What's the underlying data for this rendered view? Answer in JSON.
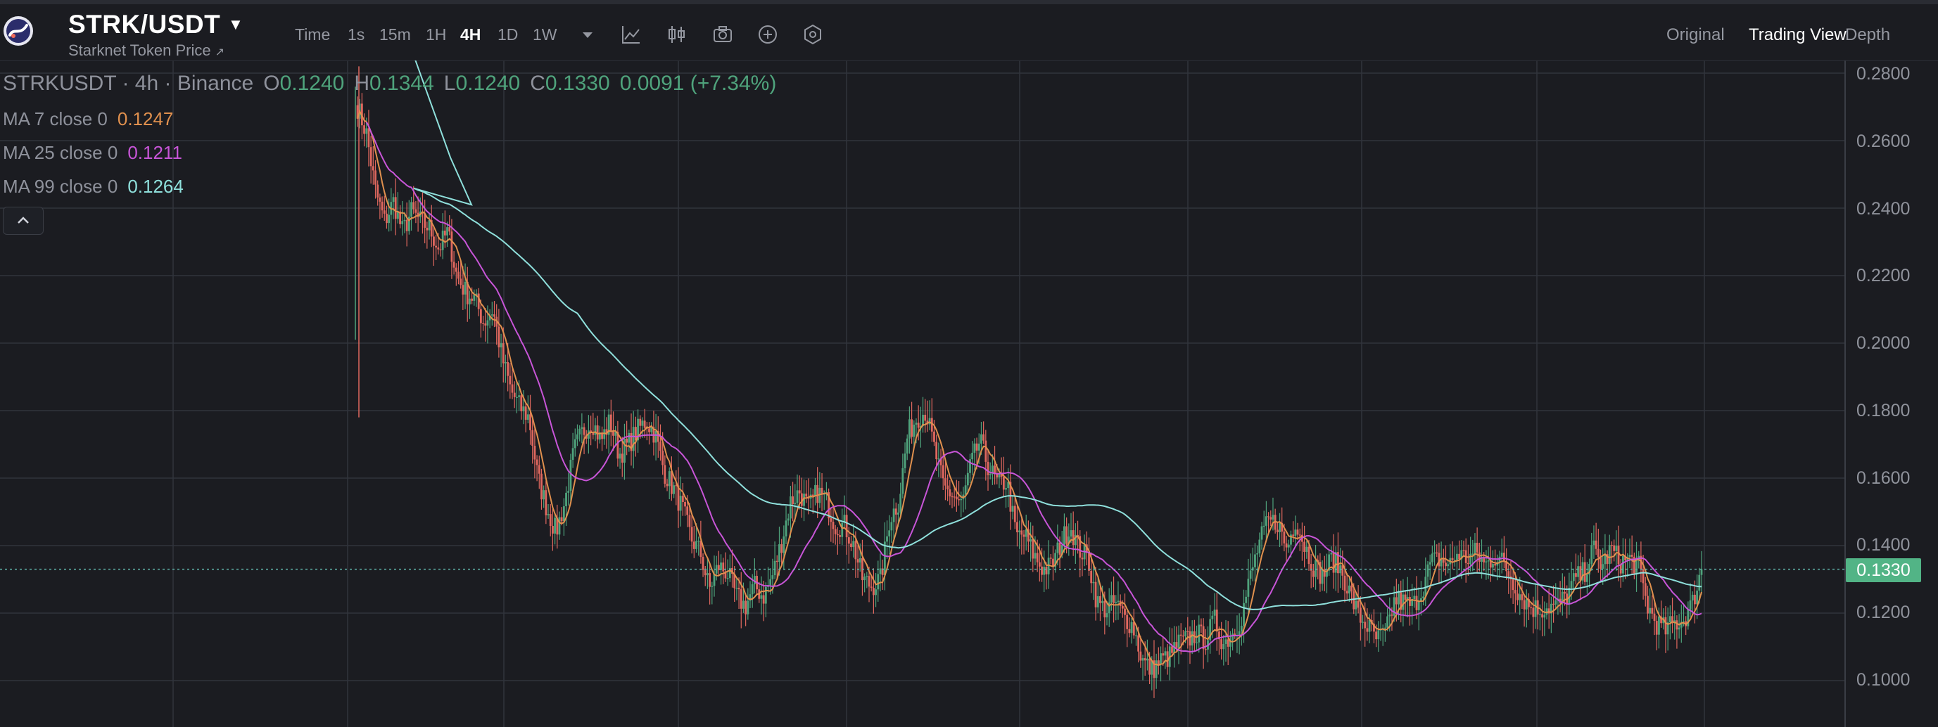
{
  "header": {
    "pair": "STRK/USDT",
    "subtitle": "Starknet Token Price",
    "subtitle_arrow": "↗",
    "intervals": [
      {
        "label": "Time",
        "active": false
      },
      {
        "label": "1s",
        "active": false
      },
      {
        "label": "15m",
        "active": false
      },
      {
        "label": "1H",
        "active": false
      },
      {
        "label": "4H",
        "active": true
      },
      {
        "label": "1D",
        "active": false
      },
      {
        "label": "1W",
        "active": false
      }
    ],
    "toolbar_icons": [
      "more-intervals-caret-icon",
      "indicators-icon",
      "chart-style-icon",
      "screenshot-icon",
      "add-icon",
      "settings-icon"
    ],
    "views": [
      {
        "label": "Original",
        "active": false
      },
      {
        "label": "Trading View",
        "active": true
      },
      {
        "label": "Depth",
        "active": false
      }
    ]
  },
  "legend": {
    "symbol_line": "STRKUSDT · 4h · Binance",
    "open_label": "O",
    "open": "0.1240",
    "high_label": "H",
    "high": "0.1344",
    "low_label": "L",
    "low": "0.1240",
    "close_label": "C",
    "close": "0.1330",
    "change": "0.0091 (+7.34%)",
    "ma7": {
      "label": "MA 7 close 0",
      "value": "0.1247",
      "color": "#e0904e"
    },
    "ma25": {
      "label": "MA 25 close 0",
      "value": "0.1211",
      "color": "#c855d8"
    },
    "ma99": {
      "label": "MA 99 close 0",
      "value": "0.1264",
      "color": "#8fe0dc"
    }
  },
  "colors": {
    "up": "#4fa37c",
    "down": "#e0685f",
    "ma7": "#e0904e",
    "ma25": "#c855d8",
    "ma99": "#8fe0dc",
    "grid": "#31343c",
    "background": "#1b1c21",
    "price_tag": "#52b486"
  },
  "chart_data": {
    "type": "line",
    "title": "",
    "xlabel": "",
    "ylabel": "",
    "ylim": [
      0.094,
      0.284
    ],
    "y_ticks": [
      "0.2800",
      "0.2600",
      "0.2400",
      "0.2200",
      "0.2000",
      "0.1800",
      "0.1600",
      "0.1400",
      "0.1200",
      "0.1000"
    ],
    "grid": true,
    "current_price": 0.133,
    "current_price_label": "0.1330",
    "series": [
      {
        "name": "",
        "values": [
          0.27,
          0.262,
          0.245,
          0.236,
          0.242,
          0.233,
          0.239,
          0.236,
          0.234,
          0.228,
          0.233,
          0.22,
          0.215,
          0.213,
          0.206,
          0.21,
          0.196,
          0.186,
          0.181,
          0.178,
          0.16,
          0.151,
          0.144,
          0.153,
          0.168,
          0.174,
          0.177,
          0.171,
          0.177,
          0.167,
          0.17,
          0.174,
          0.177,
          0.173,
          0.162,
          0.157,
          0.151,
          0.142,
          0.138,
          0.127,
          0.134,
          0.132,
          0.125,
          0.122,
          0.128,
          0.125,
          0.131,
          0.141,
          0.153,
          0.156,
          0.151,
          0.156,
          0.153,
          0.146,
          0.146,
          0.14,
          0.13,
          0.128,
          0.13,
          0.148,
          0.153,
          0.173,
          0.178,
          0.18,
          0.168,
          0.157,
          0.155,
          0.152,
          0.164,
          0.171,
          0.163,
          0.158,
          0.159,
          0.143,
          0.143,
          0.137,
          0.133,
          0.134,
          0.141,
          0.146,
          0.139,
          0.136,
          0.123,
          0.121,
          0.123,
          0.119,
          0.116,
          0.106,
          0.103,
          0.106,
          0.107,
          0.111,
          0.112,
          0.114,
          0.112,
          0.118,
          0.111,
          0.114,
          0.119,
          0.131,
          0.141,
          0.147,
          0.147,
          0.139,
          0.148,
          0.14,
          0.134,
          0.131,
          0.136,
          0.133,
          0.126,
          0.119,
          0.116,
          0.112,
          0.114,
          0.124,
          0.123,
          0.122,
          0.127,
          0.135,
          0.136,
          0.134,
          0.138,
          0.136,
          0.138,
          0.134,
          0.137,
          0.135,
          0.13,
          0.125,
          0.122,
          0.121,
          0.122,
          0.122,
          0.125,
          0.13,
          0.132,
          0.139,
          0.134,
          0.139,
          0.135,
          0.136,
          0.134,
          0.122,
          0.117,
          0.115,
          0.117,
          0.118,
          0.123,
          0.133
        ]
      },
      {
        "name": "MA 7 close 0",
        "values": []
      },
      {
        "name": "MA 25 close 0",
        "values": []
      },
      {
        "name": "MA 99 close 0",
        "values": []
      }
    ]
  }
}
